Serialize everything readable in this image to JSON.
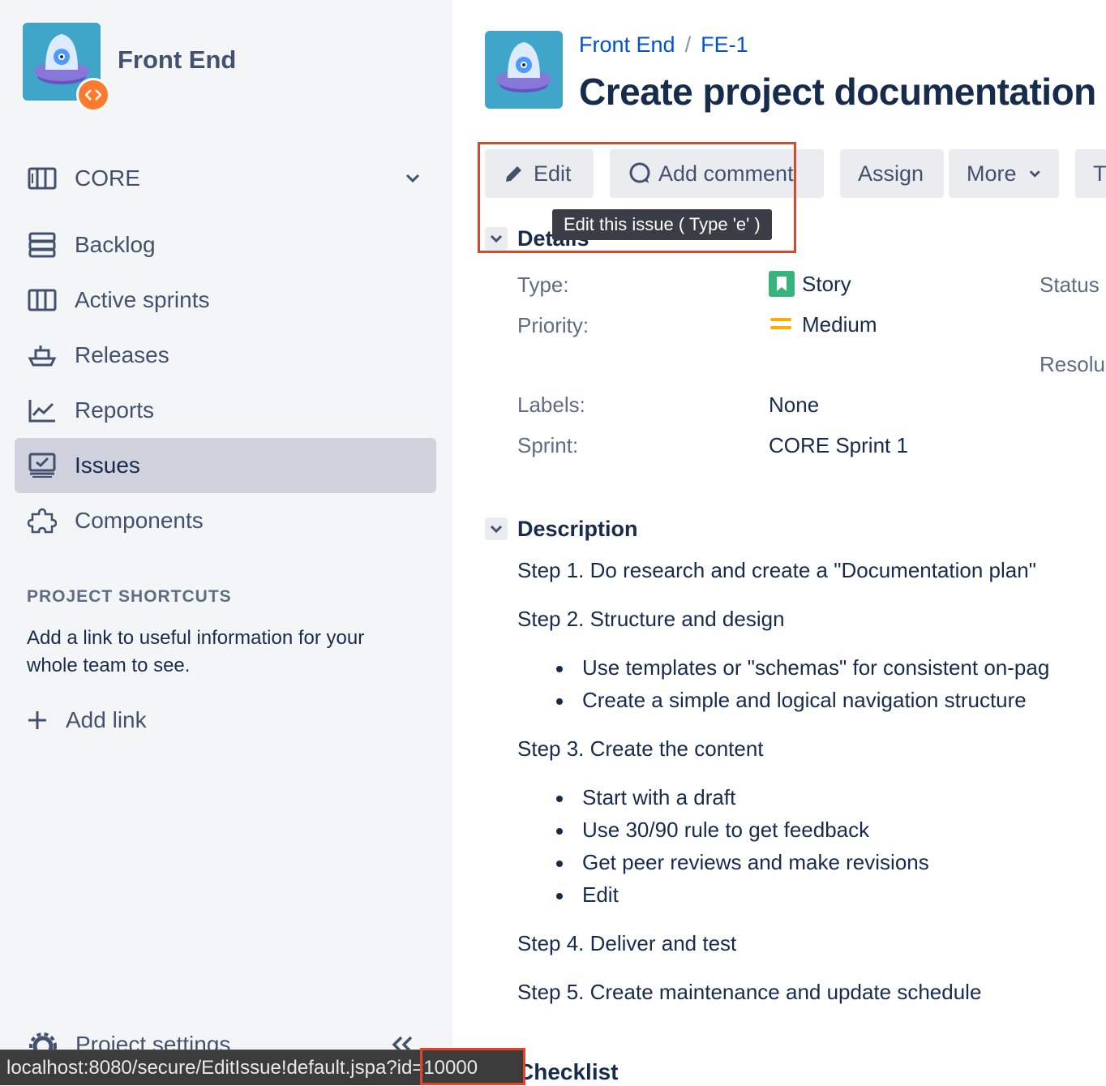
{
  "sidebar": {
    "project_name": "Front End",
    "board": {
      "label": "CORE"
    },
    "items": [
      {
        "label": "Backlog",
        "icon": "backlog-icon"
      },
      {
        "label": "Active sprints",
        "icon": "active-sprints-icon"
      },
      {
        "label": "Releases",
        "icon": "ship-icon"
      },
      {
        "label": "Reports",
        "icon": "reports-chart-icon"
      },
      {
        "label": "Issues",
        "icon": "issues-icon",
        "selected": true
      },
      {
        "label": "Components",
        "icon": "puzzle-icon"
      }
    ],
    "shortcuts": {
      "title": "PROJECT SHORTCUTS",
      "description": "Add a link to useful information for your whole team to see.",
      "add_link": "Add link"
    },
    "settings": "Project settings"
  },
  "status_bar": {
    "url": "localhost:8080/secure/EditIssue!default.jspa?id=10000"
  },
  "issue": {
    "breadcrumb": {
      "project": "Front End",
      "key": "FE-1"
    },
    "title": "Create project documentation",
    "toolbar": {
      "edit": "Edit",
      "add_comment": "Add comment",
      "assign": "Assign",
      "more": "More",
      "next_partial": "T"
    },
    "tooltip": "Edit this issue ( Type 'e' )",
    "details": {
      "heading": "Details",
      "type_label": "Type:",
      "type_value": "Story",
      "priority_label": "Priority:",
      "priority_value": "Medium",
      "labels_label": "Labels:",
      "labels_value": "None",
      "sprint_label": "Sprint:",
      "sprint_value": "CORE Sprint 1",
      "status_label": "Status",
      "resolution_label": "Resolu"
    },
    "description": {
      "heading": "Description",
      "step1": "Step 1. Do research and create a \"Documentation plan\"",
      "step2": "Step 2. Structure and design",
      "step2_items": [
        "Use templates or \"schemas\" for consistent on-pag",
        "Create a simple and logical navigation structure"
      ],
      "step3": "Step 3. Create the content",
      "step3_items": [
        "Start with a draft",
        "Use 30/90 rule to get feedback",
        "Get peer reviews and make revisions",
        "Edit"
      ],
      "step4": "Step 4. Deliver and test",
      "step5": "Step 5. Create maintenance and update schedule"
    },
    "checklist_heading": "Checklist"
  },
  "colors": {
    "link": "#0052CC",
    "highlight": "#E0452B",
    "story_green": "#36B37E",
    "medium_orange": "#FFAB00"
  }
}
